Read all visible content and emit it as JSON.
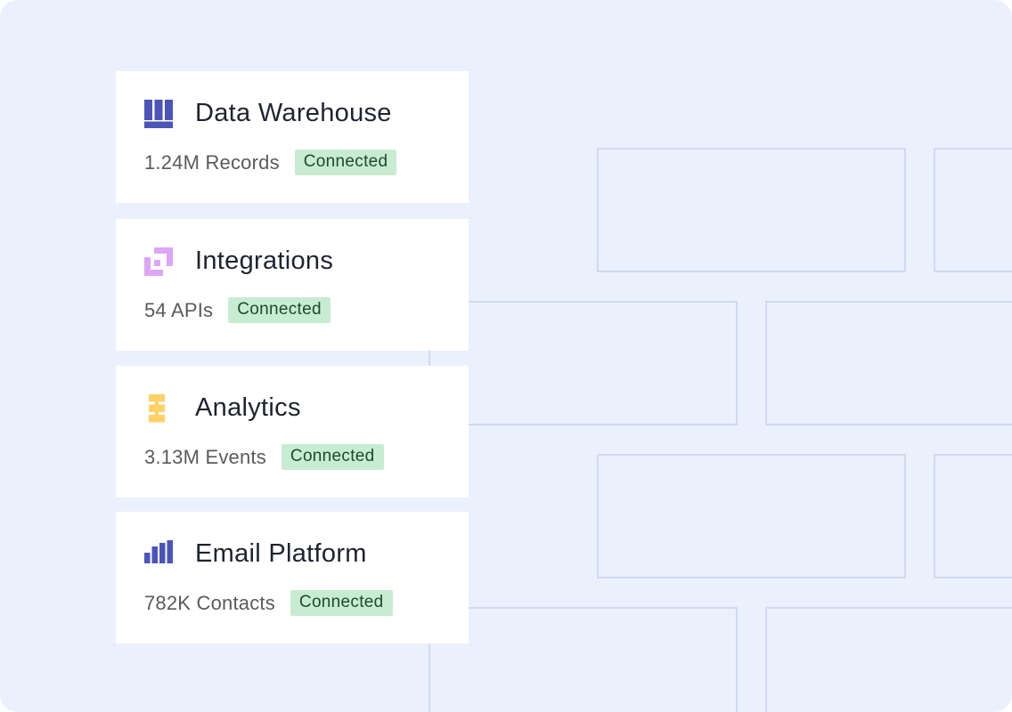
{
  "sources": [
    {
      "icon": "warehouse-icon",
      "title": "Data Warehouse",
      "count": "1.24M Records",
      "status": "Connected"
    },
    {
      "icon": "integrations-icon",
      "title": "Integrations",
      "count": "54 APIs",
      "status": "Connected"
    },
    {
      "icon": "analytics-icon",
      "title": "Analytics",
      "count": "3.13M Events",
      "status": "Connected"
    },
    {
      "icon": "bar-chart-icon",
      "title": "Email Platform",
      "count": "782K Contacts",
      "status": "Connected"
    }
  ],
  "colors": {
    "background": "#eaf1fc",
    "card": "#ffffff",
    "grid_line": "#c9cff0",
    "badge_bg": "#c8ecd2",
    "badge_text": "#1d4a2d",
    "warehouse_icon": "#4b55b8",
    "integrations_icon": "#dca6f5",
    "analytics_icon": "#ffd166",
    "email_icon": "#4b55b8"
  }
}
